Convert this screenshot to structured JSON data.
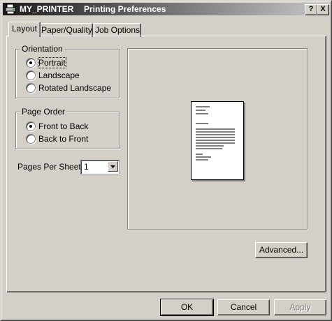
{
  "window": {
    "printer_name": "MY_PRINTER",
    "title": "Printing Preferences",
    "help_button": "?",
    "close_button": "X"
  },
  "tabs": [
    {
      "label": "Layout",
      "active": true
    },
    {
      "label": "Paper/Quality",
      "active": false
    },
    {
      "label": "Job Options",
      "active": false
    }
  ],
  "orientation": {
    "legend": "Orientation",
    "options": [
      "Portrait",
      "Landscape",
      "Rotated Landscape"
    ],
    "selected": "Portrait"
  },
  "page_order": {
    "legend": "Page Order",
    "options": [
      "Front to Back",
      "Back to Front"
    ],
    "selected": "Front to Back"
  },
  "pages_per_sheet": {
    "label": "Pages Per Sheet:",
    "value": "1"
  },
  "buttons": {
    "advanced": "Advanced...",
    "ok": "OK",
    "cancel": "Cancel",
    "apply": "Apply"
  },
  "colors": {
    "face": "#d4d0c8",
    "title_start": "#1b1b1b",
    "title_end": "#c8c8c8"
  },
  "icons": [
    "printer-icon",
    "question-mark-icon",
    "close-icon",
    "chevron-down-icon"
  ]
}
